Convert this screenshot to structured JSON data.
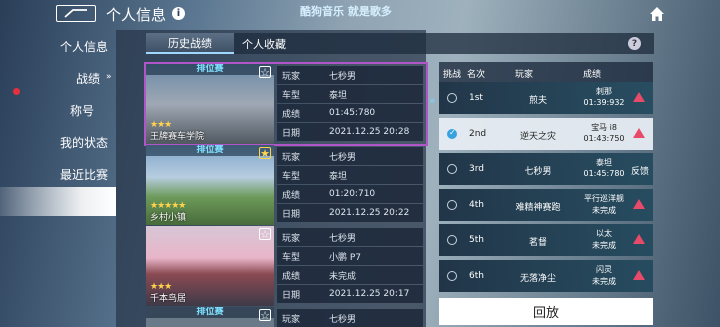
{
  "header": {
    "title": "个人信息",
    "music": "酷狗音乐  就是歌多"
  },
  "sidebar": {
    "items": [
      "个人信息",
      "战绩",
      "称号",
      "我的状态",
      "最近比赛"
    ]
  },
  "tabs": [
    "历史战绩",
    "个人收藏"
  ],
  "history": [
    {
      "tag": "排位赛",
      "stars": "★★★",
      "name": "王牌赛车学院",
      "player": "七秒男",
      "car": "泰坦",
      "score": "01:45:780",
      "date": "2021.12.25 20:28",
      "fav": "☆"
    },
    {
      "tag": "排位赛",
      "stars": "★★★★★",
      "name": "乡村小镇",
      "player": "七秒男",
      "car": "泰坦",
      "score": "01:20:710",
      "date": "2021.12.25 20:22",
      "fav": "★"
    },
    {
      "tag": "排位赛",
      "stars": "★★★",
      "name": "千本鸟居",
      "player": "七秒男",
      "car": "小鹏 P7",
      "score": "未完成",
      "date": "2021.12.25 20:17",
      "fav": "☆"
    },
    {
      "tag": "排位赛",
      "stars": "",
      "name": "",
      "player": "七秒男",
      "car": "",
      "score": "",
      "date": "",
      "fav": "☆"
    }
  ],
  "labels": {
    "player": "玩家",
    "car": "车型",
    "score": "成绩",
    "date": "日期"
  },
  "ranking": {
    "headers": [
      "挑战",
      "名次",
      "玩家",
      "成绩"
    ],
    "rows": [
      {
        "rank": "1st",
        "player": "煎夫",
        "car": "刺那",
        "time": "01:39:932"
      },
      {
        "rank": "2nd",
        "player": "逆天之灾",
        "car": "宝马 i8",
        "time": "01:43:750"
      },
      {
        "rank": "3rd",
        "player": "七秒男",
        "car": "泰坦",
        "time": "01:45:780",
        "extra": "反馈"
      },
      {
        "rank": "4th",
        "player": "难精神赛跑",
        "car": "平行巡洋舰",
        "time": "未完成"
      },
      {
        "rank": "5th",
        "player": "茗督",
        "car": "以太",
        "time": "未完成"
      },
      {
        "rank": "6th",
        "player": "无落净尘",
        "car": "闪灵",
        "time": "未完成"
      }
    ]
  },
  "replay": "回放"
}
